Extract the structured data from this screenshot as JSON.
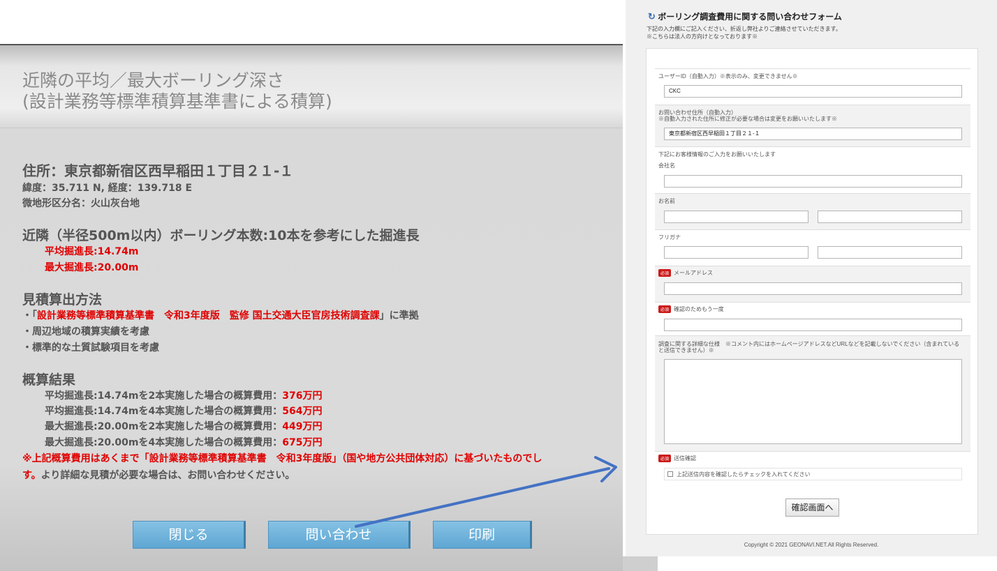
{
  "left": {
    "title_line1": "近隣の平均／最大ボーリング深さ",
    "title_line2": "(設計業務等標準積算基準書による積算)",
    "address": "住所：東京都新宿区西早稲田１丁目２１-１",
    "coords": "緯度：35.711 N, 経度：139.718 E",
    "landform": "微地形区分名：火山灰台地",
    "nearby_heading": "近隣（半径500m以内）ボーリング本数:10本を参考にした掘進長",
    "avg_depth": "平均掘進長:14.74m",
    "max_depth": "最大掘進長:20.00m",
    "method_heading": "見積算出方法",
    "method_1_prefix": "・「",
    "method_1_red": "設計業務等標準積算基準書　令和3年度版　監修 国土交通大臣官房技術調査課",
    "method_1_suffix": "」に準拠",
    "method_2": "・周辺地域の積算実績を考慮",
    "method_3": "・標準的な土質試験項目を考慮",
    "result_heading": "概算結果",
    "results": [
      {
        "label": "平均掘進長:14.74mを2本実施した場合の概算費用：",
        "value": "376万円"
      },
      {
        "label": "平均掘進長:14.74mを4本実施した場合の概算費用：",
        "value": "564万円"
      },
      {
        "label": "最大掘進長:20.00mを2本実施した場合の概算費用：",
        "value": "449万円"
      },
      {
        "label": "最大掘進長:20.00mを4本実施した場合の概算費用：",
        "value": "675万円"
      }
    ],
    "note_red_1": "※上記概算費用はあくまで「設計業務等標準積算基準書　令和3年度版」（国や地方公共団体対応）に基づいたものでし",
    "note_red_2": "す。",
    "note_black_2": "より詳細な見積が必要な場合は、お問い合わせください。",
    "btn_close": "閉じる",
    "btn_inquiry": "問い合わせ",
    "btn_print": "印刷"
  },
  "form": {
    "title": "ボーリング調査費用に関する問い合わせフォーム",
    "note_1": "下記の入力欄にご記入ください、折返し弊社よりご連絡させていただきます。",
    "note_2": "※こちらは法人の方向けとなっております※",
    "user_id_label": "ユーザーID（自動入力）※表示のみ、変更できません※",
    "user_id_value": "CKC",
    "address_label_1": "お問い合わせ住所（自動入力）",
    "address_label_2": "※自動入力された住所に修正が必要な場合は変更をお願いいたします※",
    "address_value": "東京都新宿区西早稲田１丁目２１-１",
    "customer_note": "下記にお客様情報のご入力をお願いいたします",
    "company_label": "会社名",
    "name_label": "お名前",
    "furigana_label": "フリガナ",
    "required_badge": "必須",
    "email_label": "メールアドレス",
    "email_confirm_label": "確認のためもう一度",
    "details_label_1": "調査に関する詳細な仕様　※コメント内にはホームページアドレスなどURLなどを記載しないでください（含まれている",
    "details_label_2": "と送信できません）※",
    "send_confirm_label": "送信確認",
    "checkbox_label": "上記送信内容を確認したらチェックを入れてください",
    "confirm_button": "確認画面へ",
    "copyright": "Copyright © 2021 GEONAVI.NET.All Rights Reserved."
  },
  "colors": {
    "accent_red": "#e00000",
    "button_blue": "#6fb3dc",
    "arrow_blue": "#4472c4"
  }
}
